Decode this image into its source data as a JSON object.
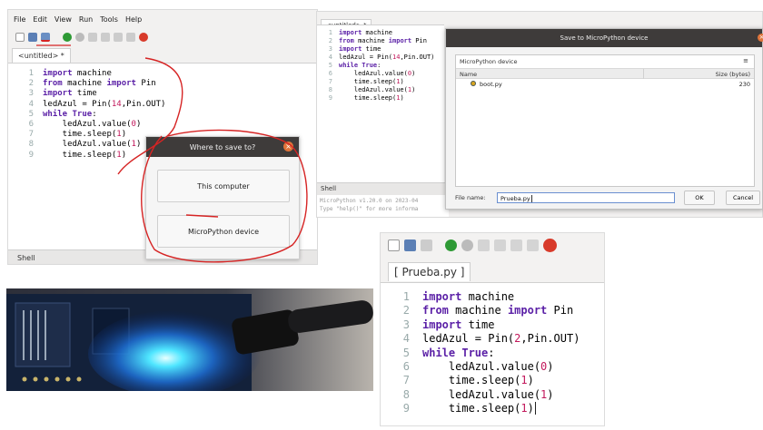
{
  "left_window": {
    "menu": [
      "File",
      "Edit",
      "View",
      "Run",
      "Tools",
      "Help"
    ],
    "tab_label": "<untitled> *",
    "shell_label": "Shell",
    "line_numbers": [
      "1",
      "2",
      "3",
      "4",
      "5",
      "6",
      "7",
      "8",
      "9"
    ]
  },
  "code": {
    "l1_kw": "import",
    "l1_rest": " machine",
    "l2_kw1": "from",
    "l2_mid": " machine ",
    "l2_kw2": "import",
    "l2_rest": " Pin",
    "l3_kw": "import",
    "l3_rest": " time",
    "l4_a": "ledAzul = Pin(",
    "l4_n1": "14",
    "l4_b": ",Pin.OUT)",
    "l5_kw": "while",
    "l5_kw2": " True",
    "l5_rest": ":",
    "l6_a": "    ledAzul.value(",
    "l6_n": "0",
    "l6_b": ")",
    "l7_a": "    time.sleep(",
    "l7_n": "1",
    "l7_b": ")",
    "l8_a": "    ledAzul.value(",
    "l8_n": "1",
    "l8_b": ")",
    "l9_a": "    time.sleep(",
    "l9_n": "1",
    "l9_b": ")"
  },
  "where_dialog": {
    "title": "Where to save to?",
    "option_computer": "This computer",
    "option_device": "MicroPython device",
    "close_glyph": "×"
  },
  "right_window": {
    "tab_label": "<untitled> *",
    "shell_label": "Shell",
    "shell_line1": "MicroPython v1.20.0 on 2023-04",
    "shell_line2": "Type \"help()\" for more informa"
  },
  "save_dialog": {
    "title": "Save to MicroPython device",
    "location": "MicroPython device",
    "col_name": "Name",
    "col_size": "Size (bytes)",
    "file_name": "boot.py",
    "file_size": "230",
    "filename_label": "File name:",
    "filename_value": "Prueba.py",
    "ok_label": "OK",
    "cancel_label": "Cancel"
  },
  "zoom_window": {
    "tab_label": "[ Prueba.py ]",
    "l4_n1": "2"
  },
  "colors": {
    "keyword": "#5a1fa6",
    "number": "#c2185b",
    "annotation_red": "#d62424",
    "led_blue": "#2fd0ff"
  }
}
